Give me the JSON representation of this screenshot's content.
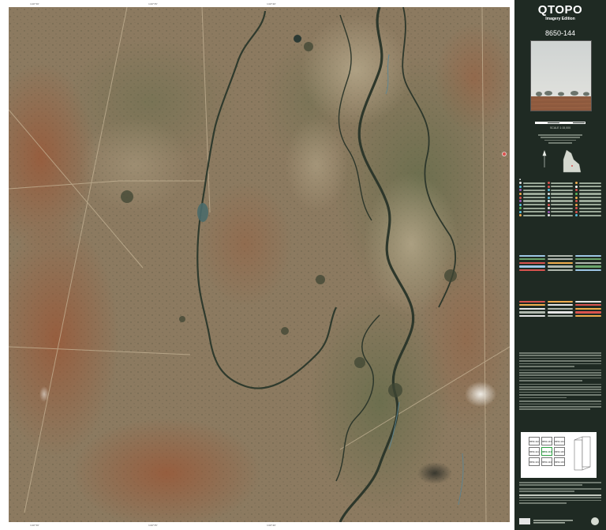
{
  "map": {
    "edge_ticks_top": [
      "149°30'",
      "149°35'",
      "149°40'"
    ],
    "edge_ticks_bottom": [
      "149°30'",
      "149°35'",
      "149°40'"
    ]
  },
  "legend": {
    "title": "QTOPO",
    "subtitle": "Imagery Edition",
    "sheet_number": "8650-144",
    "scale": "SCALE 1:15,000"
  },
  "index_map": {
    "cells": [
      "8650-142",
      "8650-143",
      "8650-144",
      "8650-141",
      "8650-144",
      "8650-146",
      "8650-131",
      "8650-134",
      "8650-133"
    ],
    "current_index": 4
  },
  "colors": {
    "panel_bg": "#1f2a23",
    "imagery_base": "#8d7a5f",
    "river": "#2e3a2c",
    "highlight": "#2ea043"
  }
}
